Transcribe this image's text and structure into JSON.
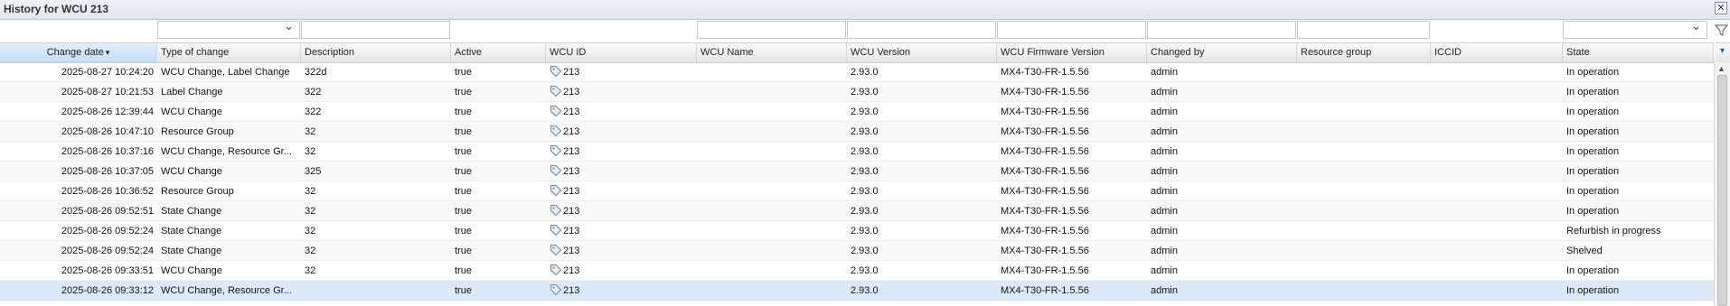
{
  "window": {
    "title": "History for WCU 213",
    "close_glyph": "✕"
  },
  "columns": [
    {
      "key": "date",
      "label": "Change date"
    },
    {
      "key": "type",
      "label": "Type of change"
    },
    {
      "key": "desc",
      "label": "Description"
    },
    {
      "key": "active",
      "label": "Active"
    },
    {
      "key": "wcuid",
      "label": "WCU ID"
    },
    {
      "key": "name",
      "label": "WCU Name"
    },
    {
      "key": "version",
      "label": "WCU Version"
    },
    {
      "key": "fw",
      "label": "WCU Firmware Version"
    },
    {
      "key": "by",
      "label": "Changed by"
    },
    {
      "key": "rg",
      "label": "Resource group"
    },
    {
      "key": "iccid",
      "label": "ICCID"
    },
    {
      "key": "state",
      "label": "State"
    }
  ],
  "sort": {
    "column": "Change date",
    "direction": "descending",
    "arrow": "▾"
  },
  "rows": [
    {
      "date": "2025-08-27 10:24:20",
      "type": "WCU Change, Label Change",
      "desc": "322d",
      "active": "true",
      "wcuid": "213",
      "name": "",
      "version": "2.93.0",
      "fw": "MX4-T30-FR-1.5.56",
      "by": "admin",
      "rg": "",
      "iccid": "",
      "state": "In operation"
    },
    {
      "date": "2025-08-27 10:21:53",
      "type": "Label Change",
      "desc": "322",
      "active": "true",
      "wcuid": "213",
      "name": "",
      "version": "2.93.0",
      "fw": "MX4-T30-FR-1.5.56",
      "by": "admin",
      "rg": "",
      "iccid": "",
      "state": "In operation"
    },
    {
      "date": "2025-08-26 12:39:44",
      "type": "WCU Change",
      "desc": "322",
      "active": "true",
      "wcuid": "213",
      "name": "",
      "version": "2.93.0",
      "fw": "MX4-T30-FR-1.5.56",
      "by": "admin",
      "rg": "",
      "iccid": "",
      "state": "In operation"
    },
    {
      "date": "2025-08-26 10:47:10",
      "type": "Resource Group",
      "desc": "32",
      "active": "true",
      "wcuid": "213",
      "name": "",
      "version": "2.93.0",
      "fw": "MX4-T30-FR-1.5.56",
      "by": "admin",
      "rg": "",
      "iccid": "",
      "state": "In operation"
    },
    {
      "date": "2025-08-26 10:37:16",
      "type": "WCU Change, Resource Gr...",
      "desc": "32",
      "active": "true",
      "wcuid": "213",
      "name": "",
      "version": "2.93.0",
      "fw": "MX4-T30-FR-1.5.56",
      "by": "admin",
      "rg": "",
      "iccid": "",
      "state": "In operation"
    },
    {
      "date": "2025-08-26 10:37:05",
      "type": "WCU Change",
      "desc": "325",
      "active": "true",
      "wcuid": "213",
      "name": "",
      "version": "2.93.0",
      "fw": "MX4-T30-FR-1.5.56",
      "by": "admin",
      "rg": "",
      "iccid": "",
      "state": "In operation"
    },
    {
      "date": "2025-08-26 10:36:52",
      "type": "Resource Group",
      "desc": "32",
      "active": "true",
      "wcuid": "213",
      "name": "",
      "version": "2.93.0",
      "fw": "MX4-T30-FR-1.5.56",
      "by": "admin",
      "rg": "",
      "iccid": "",
      "state": "In operation"
    },
    {
      "date": "2025-08-26 09:52:51",
      "type": "State Change",
      "desc": "32",
      "active": "true",
      "wcuid": "213",
      "name": "",
      "version": "2.93.0",
      "fw": "MX4-T30-FR-1.5.56",
      "by": "admin",
      "rg": "",
      "iccid": "",
      "state": "In operation"
    },
    {
      "date": "2025-08-26 09:52:24",
      "type": "State Change",
      "desc": "32",
      "active": "true",
      "wcuid": "213",
      "name": "",
      "version": "2.93.0",
      "fw": "MX4-T30-FR-1.5.56",
      "by": "admin",
      "rg": "",
      "iccid": "",
      "state": "Refurbish in progress"
    },
    {
      "date": "2025-08-26 09:52:24",
      "type": "State Change",
      "desc": "32",
      "active": "true",
      "wcuid": "213",
      "name": "",
      "version": "2.93.0",
      "fw": "MX4-T30-FR-1.5.56",
      "by": "admin",
      "rg": "",
      "iccid": "",
      "state": "Shelved"
    },
    {
      "date": "2025-08-26 09:33:51",
      "type": "WCU Change",
      "desc": "32",
      "active": "true",
      "wcuid": "213",
      "name": "",
      "version": "2.93.0",
      "fw": "MX4-T30-FR-1.5.56",
      "by": "admin",
      "rg": "",
      "iccid": "",
      "state": "In operation"
    },
    {
      "date": "2025-08-26 09:33:12",
      "type": "WCU Change, Resource Gr...",
      "desc": "",
      "active": "true",
      "wcuid": "213",
      "name": "",
      "version": "2.93.0",
      "fw": "MX4-T30-FR-1.5.56",
      "by": "admin",
      "rg": "",
      "iccid": "",
      "state": "In operation",
      "selected": true
    }
  ],
  "icons": {
    "wcu_id": "tag-icon",
    "filter": "funnel-icon",
    "header_menu": "chevron-down-icon"
  },
  "colors": {
    "selection": "#dce9f8",
    "sorted_header": "#c6dcf6",
    "accent": "#1f5fb0"
  }
}
